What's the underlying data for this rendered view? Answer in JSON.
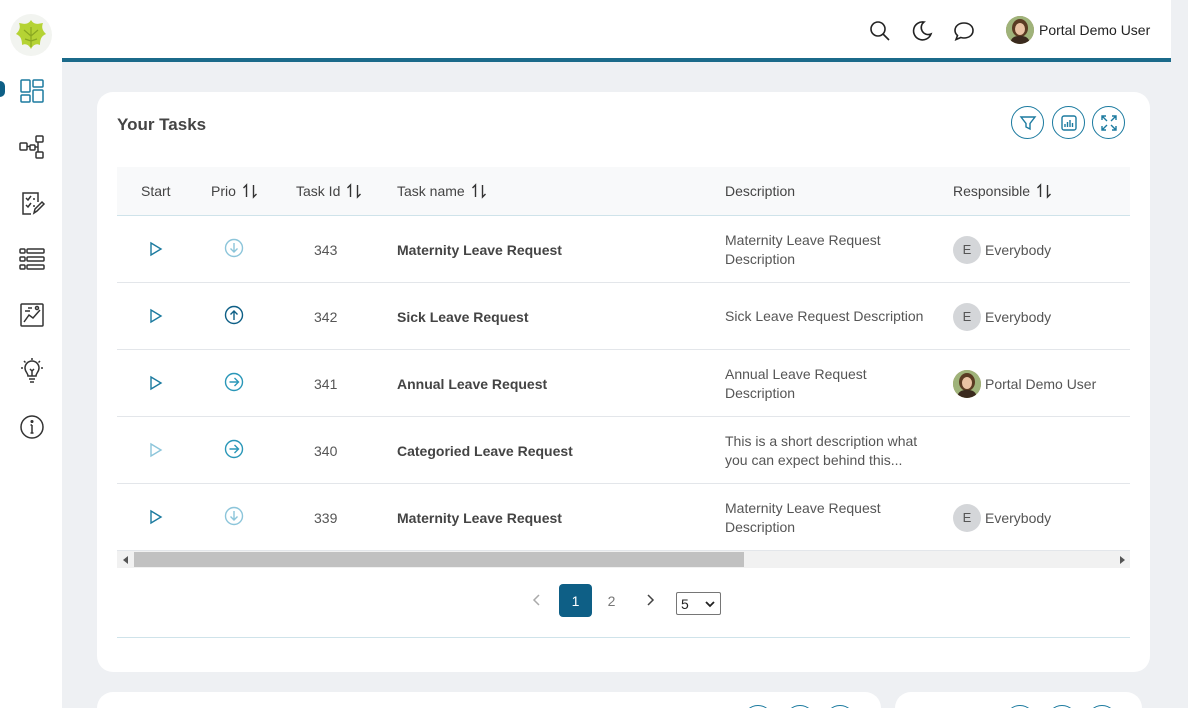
{
  "header": {
    "user_name": "Portal Demo User",
    "icons": [
      "search-icon",
      "moon-icon",
      "chat-icon"
    ]
  },
  "sidebar": {
    "items": [
      {
        "name": "dashboard-icon",
        "active": true
      },
      {
        "name": "process-icon"
      },
      {
        "name": "tasks-icon"
      },
      {
        "name": "cases-icon"
      },
      {
        "name": "statistics-icon"
      },
      {
        "name": "ideas-icon"
      },
      {
        "name": "info-icon"
      }
    ]
  },
  "tasks_card": {
    "title": "Your Tasks",
    "actions": [
      "filter-icon",
      "chart-icon",
      "expand-icon"
    ],
    "columns": {
      "start": "Start",
      "prio": "Prio",
      "task_id": "Task Id",
      "task_name": "Task name",
      "description": "Description",
      "responsible": "Responsible"
    },
    "rows": [
      {
        "prio": "low",
        "id": "343",
        "name": "Maternity Leave Request",
        "description": "Maternity Leave Request Description",
        "responsible": "Everybody",
        "responsible_initial": "E",
        "startable": true
      },
      {
        "prio": "high",
        "id": "342",
        "name": "Sick Leave Request",
        "description": "Sick Leave Request Description",
        "responsible": "Everybody",
        "responsible_initial": "E",
        "startable": true
      },
      {
        "prio": "normal",
        "id": "341",
        "name": "Annual Leave Request",
        "description": "Annual Leave Request Description",
        "responsible": "Portal Demo User",
        "responsible_initial": "",
        "startable": true
      },
      {
        "prio": "normal",
        "id": "340",
        "name": "Categoried Leave Request",
        "description": "This is a short description what you can expect behind this...",
        "responsible": "",
        "responsible_initial": "",
        "startable": false
      },
      {
        "prio": "low",
        "id": "339",
        "name": "Maternity Leave Request",
        "description": "Maternity Leave Request Description",
        "responsible": "Everybody",
        "responsible_initial": "E",
        "startable": true
      }
    ],
    "pagination": {
      "pages": [
        "1",
        "2"
      ],
      "current": "1",
      "page_size": "5"
    }
  },
  "colors": {
    "accent": "#1b7a9f",
    "accent_dark": "#0e5f86",
    "prio_low": "#8cc5da",
    "prio_high": "#0e5f86",
    "prio_normal": "#2a97b8"
  }
}
